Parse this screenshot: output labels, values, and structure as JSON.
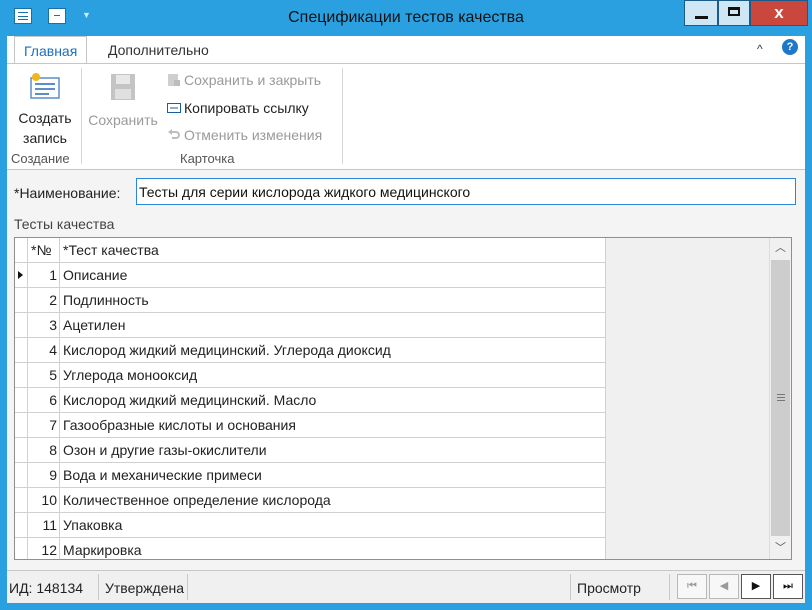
{
  "window": {
    "title": "Спецификации тестов качества",
    "close_glyph": "x",
    "colors": {
      "frame": "#2aa0e0",
      "close": "#c9473c",
      "accent": "#1e6fb8"
    }
  },
  "ribbon": {
    "tabs": [
      {
        "label": "Главная",
        "active": true
      },
      {
        "label": "Дополнительно",
        "active": false
      }
    ],
    "collapse_glyph": "^",
    "help_glyph": "?",
    "groups": {
      "create": {
        "label": "Создание",
        "create_line1": "Создать",
        "create_line2": "запись"
      },
      "card": {
        "label": "Карточка",
        "save": "Сохранить",
        "save_close": "Сохранить и закрыть",
        "copy_link": "Копировать ссылку",
        "cancel_changes": "Отменить изменения"
      }
    }
  },
  "form": {
    "name_label": "*Наименование:",
    "name_value": "Тесты для серии кислорода жидкого медицинского",
    "section_label": "Тесты качества"
  },
  "grid": {
    "columns": {
      "num": "*№",
      "name": "*Тест качества"
    },
    "rows": [
      {
        "num": "1",
        "name": "Описание"
      },
      {
        "num": "2",
        "name": "Подлинность"
      },
      {
        "num": "3",
        "name": "Ацетилен"
      },
      {
        "num": "4",
        "name": "Кислород жидкий медицинский. Углерода диоксид"
      },
      {
        "num": "5",
        "name": "Углерода монооксид"
      },
      {
        "num": "6",
        "name": "Кислород жидкий медицинский. Масло"
      },
      {
        "num": "7",
        "name": "Газообразные кислоты и основания"
      },
      {
        "num": "8",
        "name": "Озон и другие газы-окислители"
      },
      {
        "num": "9",
        "name": "Вода и механические примеси"
      },
      {
        "num": "10",
        "name": "Количественное определение кислорода"
      },
      {
        "num": "11",
        "name": "Упаковка"
      },
      {
        "num": "12",
        "name": "Маркировка"
      }
    ],
    "current_row": 1
  },
  "status": {
    "id_text": "ИД: 148134",
    "state": "Утверждена",
    "mode": "Просмотр"
  },
  "icons": {
    "window_icon": "form-icon",
    "qat": "text-field-icon",
    "create": "new-record-icon",
    "save": "floppy-disk-icon",
    "save_close": "save-close-icon",
    "copy_link": "link-icon",
    "cancel": "undo-icon"
  }
}
